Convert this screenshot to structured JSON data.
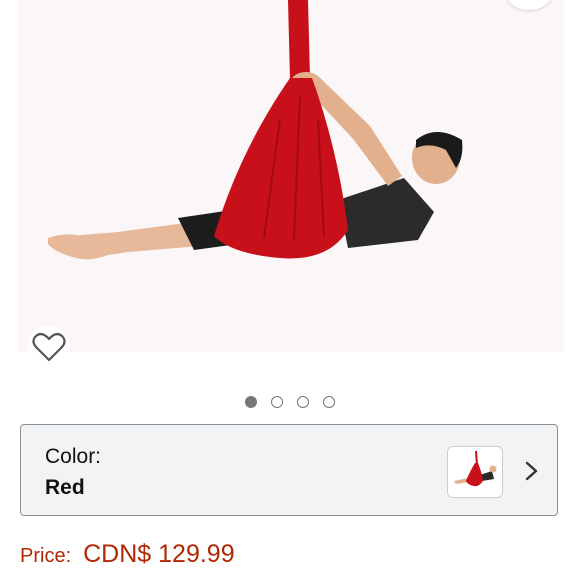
{
  "product": {
    "image_alt": "Man lying back in red aerial yoga hammock",
    "image_count": 4,
    "active_image_index": 0
  },
  "variant": {
    "label": "Color:",
    "value": "Red"
  },
  "price": {
    "label": "Price:",
    "value": "CDN$ 129.99"
  },
  "icons": {
    "wishlist": "heart-outline-icon",
    "next": "chevron-right-icon"
  },
  "colors": {
    "price": "#b12704",
    "hammock": "#c8101a",
    "active_dot": "#777777"
  }
}
